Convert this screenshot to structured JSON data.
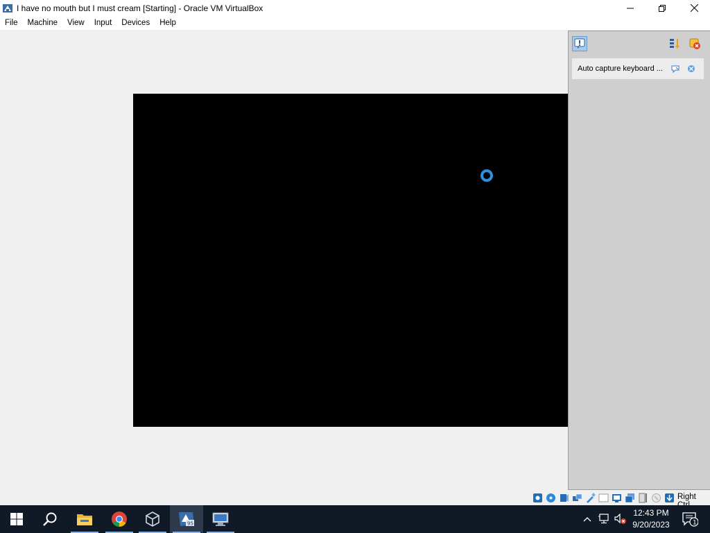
{
  "window": {
    "title": "I have no mouth but I must cream [Starting] - Oracle VM VirtualBox"
  },
  "menu": [
    "File",
    "Machine",
    "View",
    "Input",
    "Devices",
    "Help"
  ],
  "notification_panel": {
    "message": "Auto capture keyboard ..."
  },
  "statusbar": {
    "host_key": "Right Ctrl",
    "device_icons": [
      "hard-disk-icon",
      "optical-drive-icon",
      "audio-icon",
      "network-icon",
      "usb-icon",
      "shared-folders-icon",
      "display-icon",
      "recording-icon",
      "cpu-icon",
      "mouse-integration-icon",
      "keyboard-capture-icon"
    ]
  },
  "taskbar": {
    "apps": [
      "start-icon",
      "search-icon",
      "file-explorer-icon",
      "chrome-icon",
      "virtualbox-manager-icon",
      "vm-window-icon",
      "remote-desktop-icon"
    ],
    "time": "12:43 PM",
    "date": "9/20/2023",
    "notification_count": "1"
  },
  "colors": {
    "taskbar_bg": "#101926",
    "vm_screen_bg": "#000000",
    "spinner": "#2d8fe0",
    "panel_bg": "#cfcfcf"
  }
}
